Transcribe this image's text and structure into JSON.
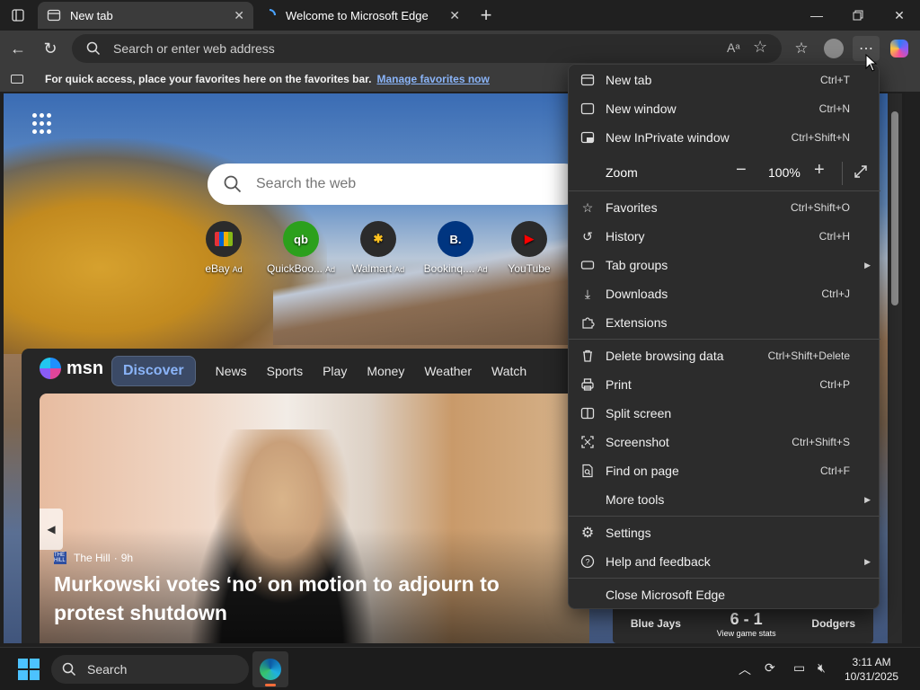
{
  "tabs": [
    {
      "title": "New tab",
      "active": true
    },
    {
      "title": "Welcome to Microsoft Edge",
      "active": false
    }
  ],
  "toolbar": {
    "address_placeholder": "Search or enter web address"
  },
  "favorites_bar": {
    "message": "For quick access, place your favorites here on the favorites bar.",
    "link": "Manage favorites now"
  },
  "newtab": {
    "search_placeholder": "Search the web",
    "quick_links": [
      {
        "label": "eBay",
        "ad": "Ad",
        "icon_text": "",
        "color": "#2b2b2b"
      },
      {
        "label": "QuickBoo...",
        "ad": "Ad",
        "icon_text": "qb",
        "color": "#2ca01c"
      },
      {
        "label": "Walmart",
        "ad": "Ad",
        "icon_text": "✱",
        "color": "#0071ce"
      },
      {
        "label": "Bookinq....",
        "ad": "Ad",
        "icon_text": "B.",
        "color": "#003580"
      },
      {
        "label": "YouTube",
        "ad": "",
        "icon_text": "▶",
        "color": "#ff0000"
      }
    ]
  },
  "msn": {
    "logo": "msn",
    "nav": [
      "Discover",
      "News",
      "Sports",
      "Play",
      "Money",
      "Weather",
      "Watch"
    ],
    "hero": {
      "source": "The Hill",
      "age": "9h",
      "headline": "Murkowski votes ‘no’ on motion to adjourn to protest shutdown"
    },
    "sports": {
      "team1": "Blue Jays",
      "score": "6 - 1",
      "link": "View game stats",
      "team2": "Dodgers"
    }
  },
  "menu": {
    "items": [
      {
        "label": "New tab",
        "shortcut": "Ctrl+T",
        "icon": "new-tab-icon"
      },
      {
        "label": "New window",
        "shortcut": "Ctrl+N",
        "icon": "new-window-icon"
      },
      {
        "label": "New InPrivate window",
        "shortcut": "Ctrl+Shift+N",
        "icon": "inprivate-icon"
      }
    ],
    "zoom": {
      "label": "Zoom",
      "value": "100%"
    },
    "items2": [
      {
        "label": "Favorites",
        "shortcut": "Ctrl+Shift+O",
        "icon": "star-icon"
      },
      {
        "label": "History",
        "shortcut": "Ctrl+H",
        "icon": "history-icon"
      },
      {
        "label": "Tab groups",
        "shortcut": "",
        "icon": "tab-groups-icon",
        "submenu": true
      },
      {
        "label": "Downloads",
        "shortcut": "Ctrl+J",
        "icon": "download-icon"
      },
      {
        "label": "Extensions",
        "shortcut": "",
        "icon": "puzzle-icon"
      }
    ],
    "items3": [
      {
        "label": "Delete browsing data",
        "shortcut": "Ctrl+Shift+Delete",
        "icon": "trash-icon"
      },
      {
        "label": "Print",
        "shortcut": "Ctrl+P",
        "icon": "print-icon"
      },
      {
        "label": "Split screen",
        "shortcut": "",
        "icon": "split-screen-icon"
      },
      {
        "label": "Screenshot",
        "shortcut": "Ctrl+Shift+S",
        "icon": "screenshot-icon"
      },
      {
        "label": "Find on page",
        "shortcut": "Ctrl+F",
        "icon": "find-icon"
      },
      {
        "label": "More tools",
        "shortcut": "",
        "icon": "",
        "submenu": true
      }
    ],
    "items4": [
      {
        "label": "Settings",
        "shortcut": "",
        "icon": "gear-icon"
      },
      {
        "label": "Help and feedback",
        "shortcut": "",
        "icon": "help-icon",
        "submenu": true
      }
    ],
    "close": "Close Microsoft Edge"
  },
  "taskbar": {
    "search": "Search",
    "time": "3:11 AM",
    "date": "10/31/2025"
  }
}
